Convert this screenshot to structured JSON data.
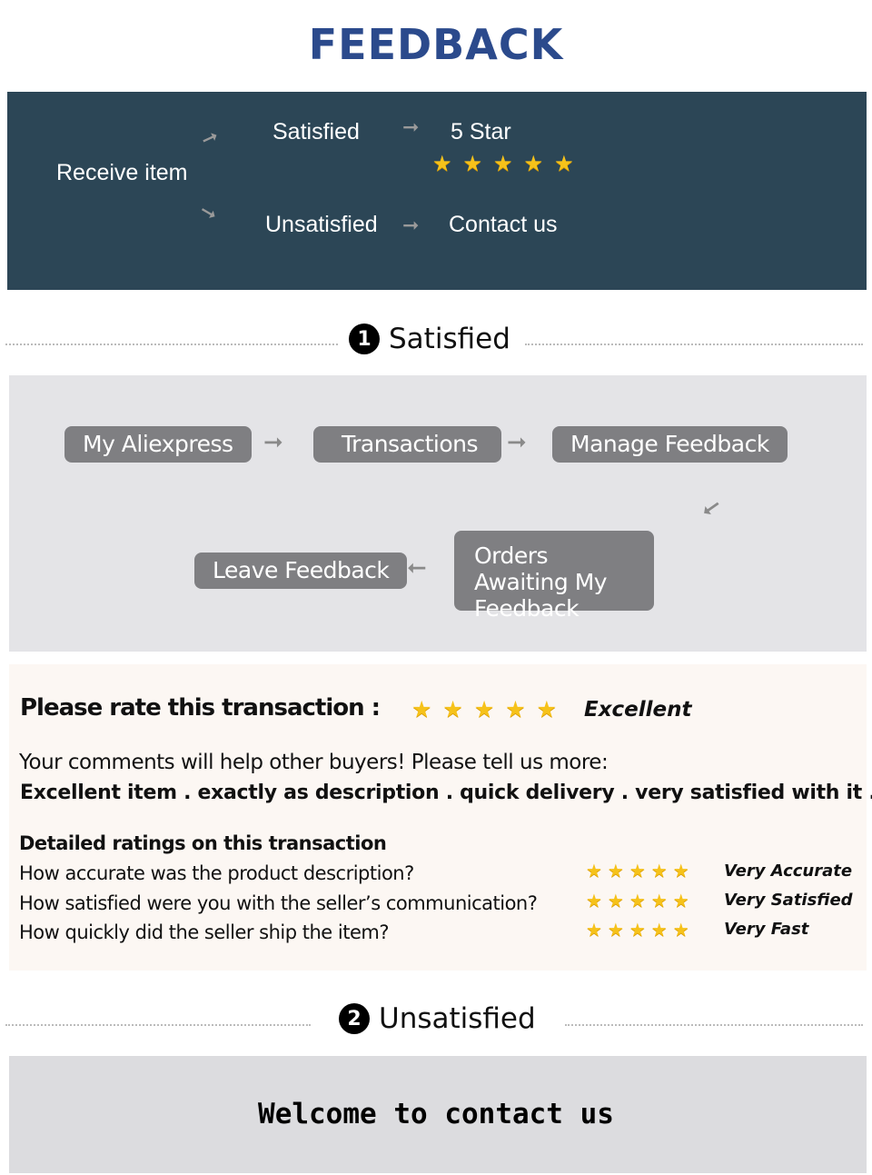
{
  "title": "FEEDBACK",
  "banner": {
    "receive": "Receive item",
    "satisfied": "Satisfied",
    "five_star": "5 Star",
    "stars": 5,
    "unsatisfied": "Unsatisfied",
    "contact": "Contact us"
  },
  "section1": {
    "number": "1",
    "label": "Satisfied"
  },
  "steps": [
    "My Aliexpress",
    "Transactions",
    "Manage Feedback",
    "Orders Awaiting My Feedback",
    "Leave Feedback"
  ],
  "rating": {
    "prompt": "Please rate this transaction :",
    "stars": 5,
    "label": "Excellent",
    "comment_prompt": "Your comments will help other buyers! Please tell us more:",
    "comment": "Excellent item . exactly as description . quick delivery . very satisfied with it .",
    "detailed_title": "Detailed ratings on this transaction",
    "details": [
      {
        "question": "How accurate was the product description?",
        "stars": 5,
        "label": "Very Accurate"
      },
      {
        "question": "How satisfied were you with the seller’s communication?",
        "stars": 5,
        "label": "Very Satisfied"
      },
      {
        "question": "How quickly did the seller ship the item?",
        "stars": 5,
        "label": "Very Fast"
      }
    ]
  },
  "section2": {
    "number": "2",
    "label": "Unsatisfied"
  },
  "welcome": "Welcome to contact us",
  "colors": {
    "title": "#2b4a8c",
    "banner": "#2c4656",
    "star": "#f6c21a",
    "pill": "#7f7f82"
  }
}
